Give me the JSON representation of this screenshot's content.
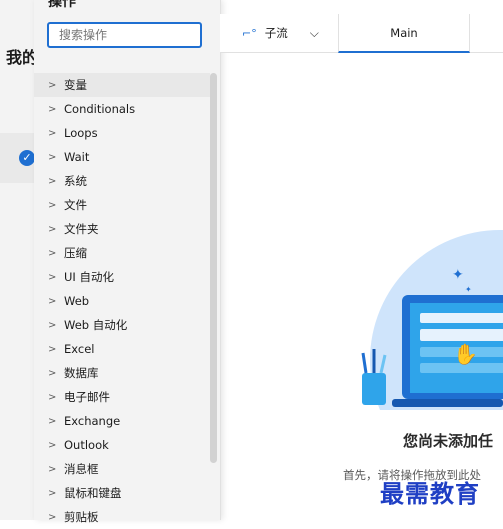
{
  "background_app": {
    "title": "我的"
  },
  "actions_panel": {
    "title": "操作",
    "search_placeholder": "搜索操作",
    "items": [
      {
        "label": "变量"
      },
      {
        "label": "Conditionals"
      },
      {
        "label": "Loops"
      },
      {
        "label": "Wait"
      },
      {
        "label": "系统"
      },
      {
        "label": "文件"
      },
      {
        "label": "文件夹"
      },
      {
        "label": "压缩"
      },
      {
        "label": "UI 自动化"
      },
      {
        "label": "Web"
      },
      {
        "label": "Web 自动化"
      },
      {
        "label": "Excel"
      },
      {
        "label": "数据库"
      },
      {
        "label": "电子邮件"
      },
      {
        "label": "Exchange"
      },
      {
        "label": "Outlook"
      },
      {
        "label": "消息框"
      },
      {
        "label": "鼠标和键盘"
      },
      {
        "label": "剪贴板"
      }
    ]
  },
  "tabs": {
    "subflows_label": "子流",
    "main_label": "Main"
  },
  "empty_state": {
    "title": "您尚未添加任",
    "description": "首先，请将操作拖放到此处"
  },
  "watermark": "最需教育",
  "colors": {
    "accent": "#1f6fd1",
    "panel_bg": "#f3f3f3"
  }
}
